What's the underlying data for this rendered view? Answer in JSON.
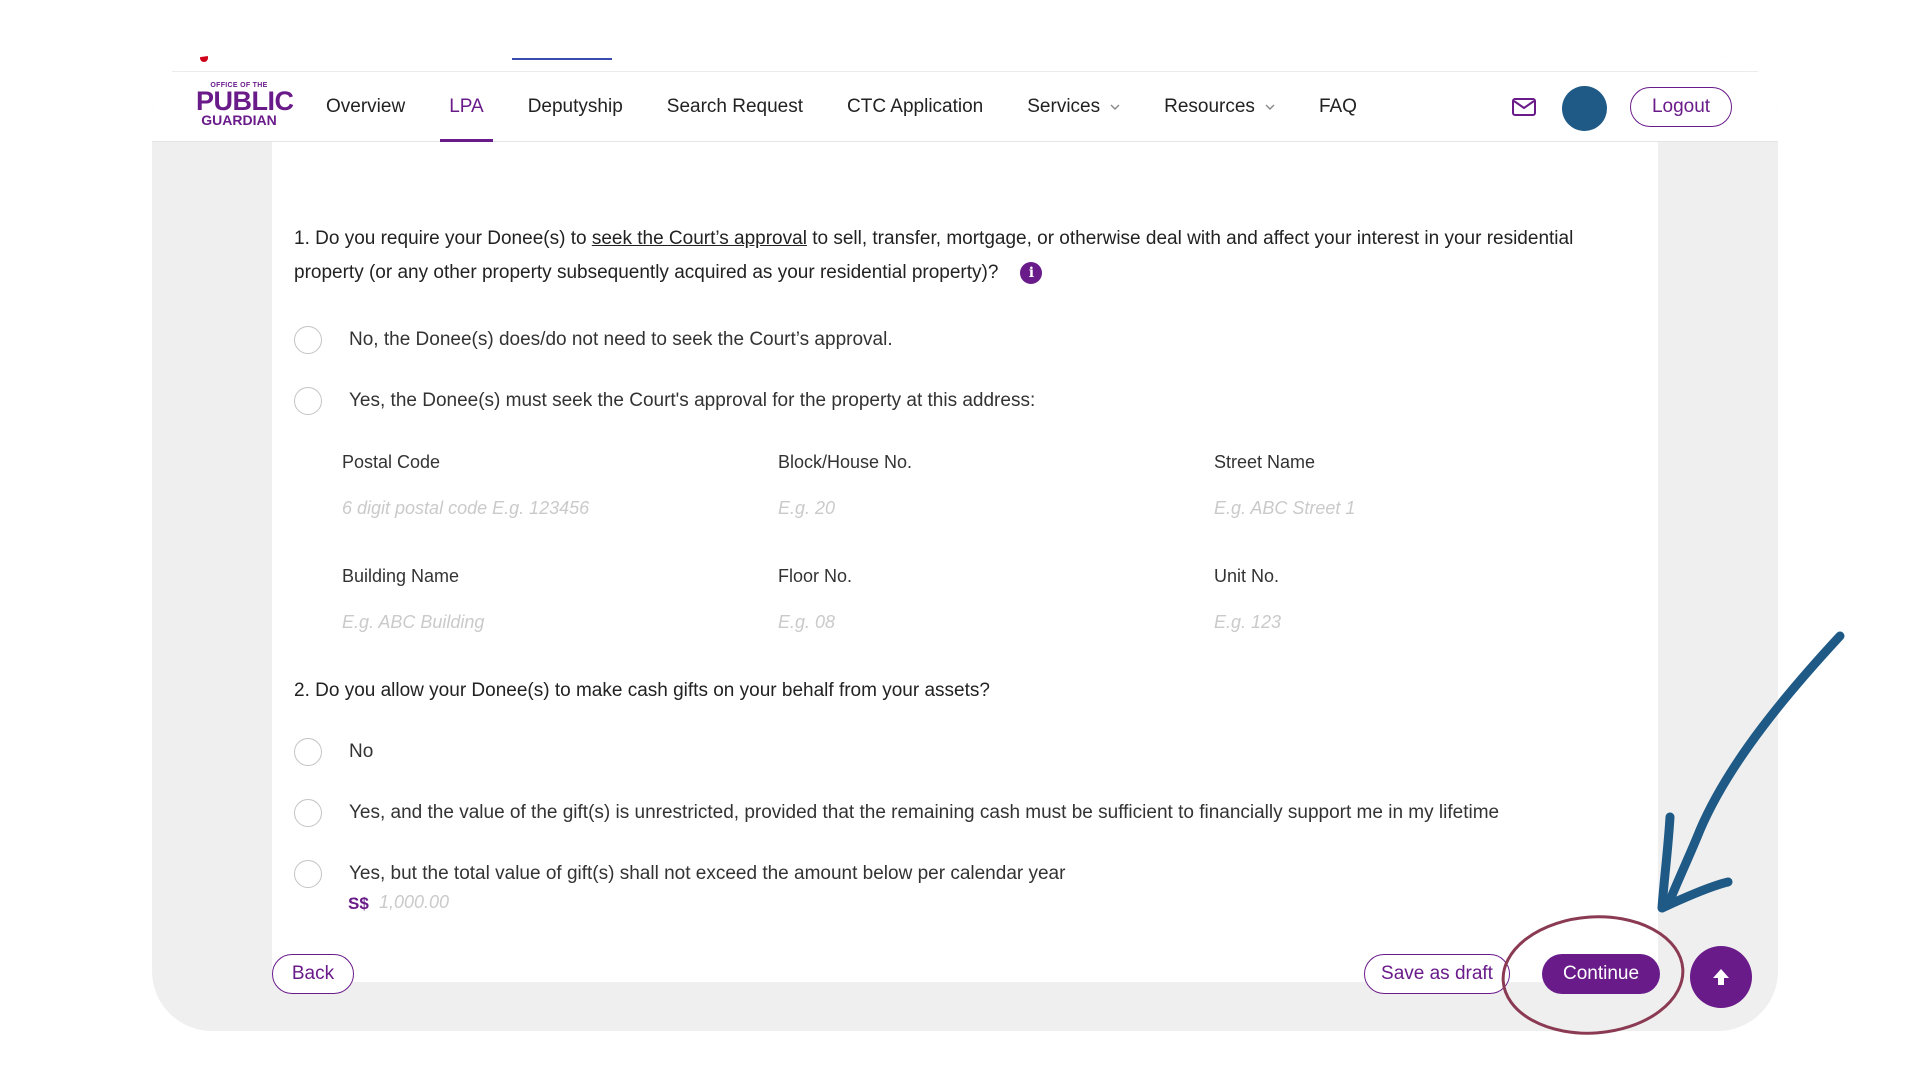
{
  "header": {
    "logo": {
      "line1": "OFFICE OF THE",
      "line2": "PUBLIC",
      "line3": "GUARDIAN"
    },
    "nav": [
      {
        "label": "Overview"
      },
      {
        "label": "LPA",
        "active": true
      },
      {
        "label": "Deputyship"
      },
      {
        "label": "Search Request"
      },
      {
        "label": "CTC Application"
      },
      {
        "label": "Services",
        "dropdown": true
      },
      {
        "label": "Resources",
        "dropdown": true
      },
      {
        "label": "FAQ"
      }
    ],
    "mail_icon": "envelope-icon",
    "logout_label": "Logout"
  },
  "form": {
    "q1": {
      "prefix": "1. Do you require your Donee(s) to ",
      "link": "seek the Court’s approval",
      "suffix": " to sell, transfer, mortgage, or otherwise deal with and affect your interest in your residential property (or any other property subsequently acquired as your residential property)?",
      "info_icon": "i",
      "options": [
        "No, the Donee(s) does/do not need to seek the Court’s approval.",
        "Yes, the Donee(s) must seek the Court's approval for the property at this address:"
      ],
      "address_fields": {
        "postal_code": {
          "label": "Postal Code",
          "placeholder": "6 digit postal code E.g. 123456"
        },
        "block": {
          "label": "Block/House No.",
          "placeholder": "E.g. 20"
        },
        "street": {
          "label": "Street Name",
          "placeholder": "E.g. ABC Street 1"
        },
        "building": {
          "label": "Building Name",
          "placeholder": "E.g. ABC Building"
        },
        "floor": {
          "label": "Floor No.",
          "placeholder": "E.g. 08"
        },
        "unit": {
          "label": "Unit No.",
          "placeholder": "E.g. 123"
        }
      }
    },
    "q2": {
      "text": "2. Do you allow your Donee(s) to make cash gifts on your behalf from your assets?",
      "options": [
        "No",
        "Yes, and the value of the gift(s) is unrestricted, provided that the remaining cash must be sufficient to financially support me in my lifetime",
        "Yes, but the total value of gift(s) shall not exceed the amount below per calendar year"
      ],
      "currency": "S$",
      "amount_placeholder": "1,000.00"
    }
  },
  "footer": {
    "back_label": "Back",
    "draft_label": "Save as draft",
    "continue_label": "Continue",
    "top_icon": "arrow-up-icon"
  },
  "colors": {
    "brand_purple": "#6a1b8a",
    "avatar_blue": "#1f5a86",
    "annotation_arrow": "#1f5a86",
    "annotation_circle": "#8a3a52"
  }
}
